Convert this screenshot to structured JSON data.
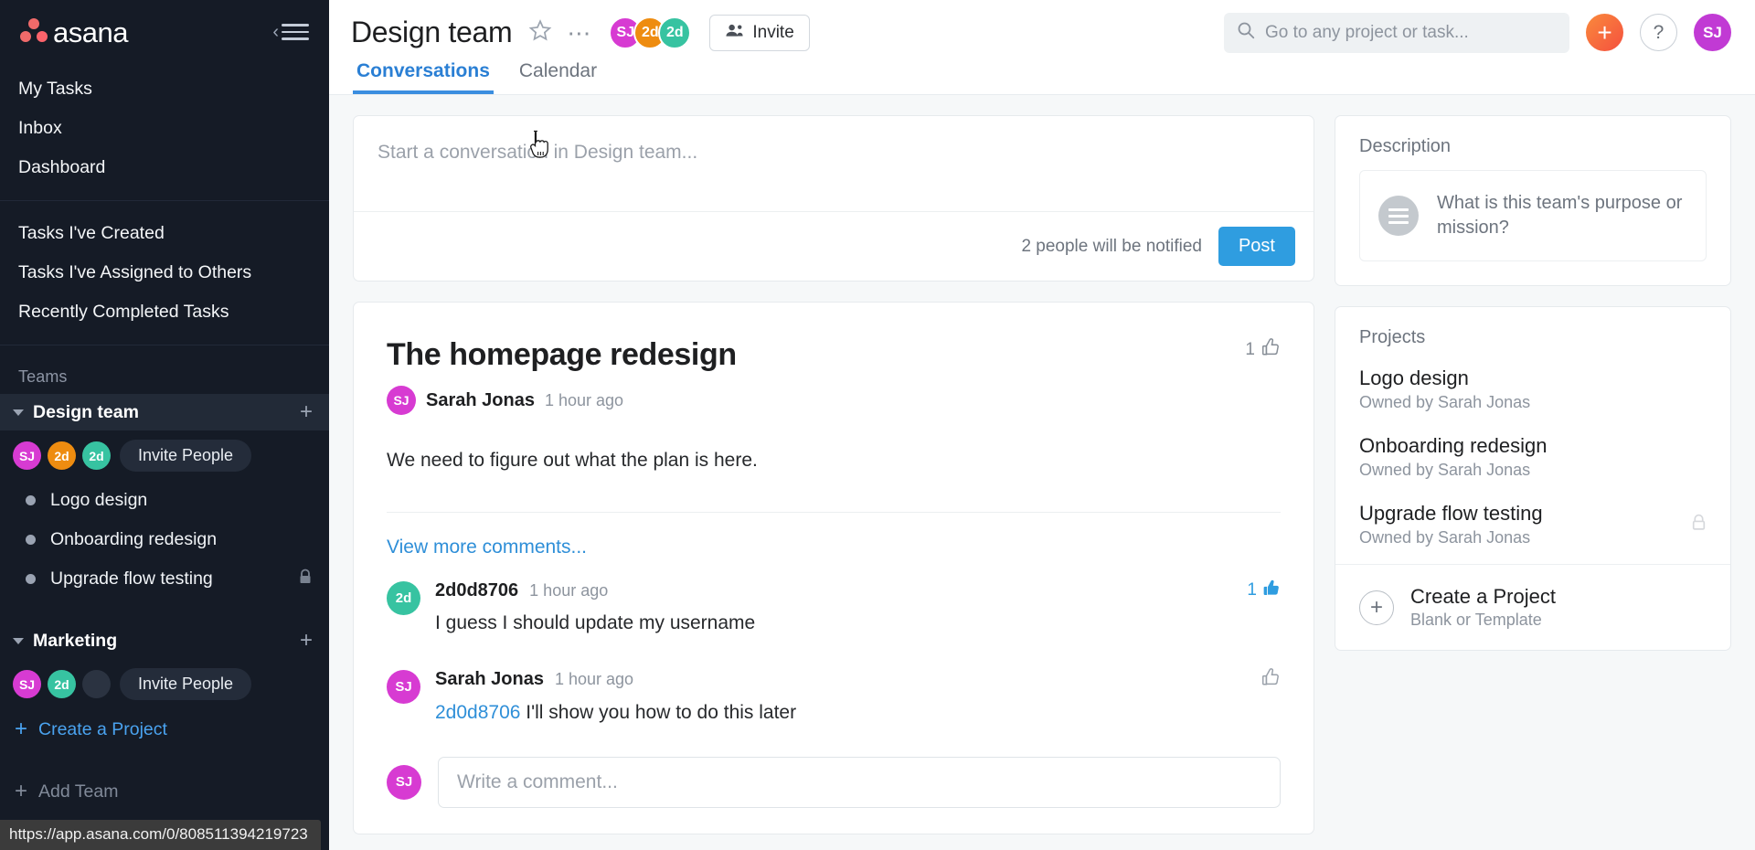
{
  "brand": {
    "name": "asana",
    "accent": "#2f9de0",
    "logo_color": "#f06a6a"
  },
  "sidebar": {
    "collapse_icon": "collapse-sidebar-icon",
    "nav": [
      {
        "label": "My Tasks"
      },
      {
        "label": "Inbox"
      },
      {
        "label": "Dashboard"
      }
    ],
    "nav2": [
      {
        "label": "Tasks I've Created"
      },
      {
        "label": "Tasks I've Assigned to Others"
      },
      {
        "label": "Recently Completed Tasks"
      }
    ],
    "teams_label": "Teams",
    "teams": [
      {
        "name": "Design team",
        "active": true,
        "members": [
          {
            "initials": "SJ",
            "color": "#d73bd2"
          },
          {
            "initials": "2d",
            "color": "#ee8c10"
          },
          {
            "initials": "2d",
            "color": "#37c3a1"
          }
        ],
        "invite_label": "Invite People",
        "projects": [
          {
            "label": "Logo design",
            "locked": false
          },
          {
            "label": "Onboarding redesign",
            "locked": false
          },
          {
            "label": "Upgrade flow testing",
            "locked": true
          }
        ]
      },
      {
        "name": "Marketing",
        "active": false,
        "members": [
          {
            "initials": "SJ",
            "color": "#d73bd2"
          },
          {
            "initials": "2d",
            "color": "#37c3a1"
          },
          {
            "initials": "",
            "color": "#2b3341"
          }
        ],
        "invite_label": "Invite People",
        "projects": []
      }
    ],
    "create_project_label": "Create a Project",
    "add_team_label": "Add Team"
  },
  "header": {
    "title": "Design team",
    "star_icon": "star-icon",
    "more_icon": "more-options-icon",
    "avatars": [
      {
        "initials": "SJ",
        "color": "#d73bd2"
      },
      {
        "initials": "2d",
        "color": "#ee8c10"
      },
      {
        "initials": "2d",
        "color": "#37c3a1"
      }
    ],
    "invite_label": "Invite",
    "search_placeholder": "Go to any project or task...",
    "add_label": "+",
    "help_label": "?",
    "me": {
      "initials": "SJ",
      "color": "#c13ad4"
    },
    "tabs": [
      {
        "label": "Conversations",
        "active": true
      },
      {
        "label": "Calendar",
        "active": false
      }
    ]
  },
  "composer": {
    "placeholder": "Start a conversation in Design team...",
    "notify_text": "2 people will be notified",
    "post_label": "Post"
  },
  "conversation": {
    "title": "The homepage redesign",
    "like_count": "1",
    "author": {
      "name": "Sarah Jonas",
      "initials": "SJ",
      "color": "#d73bd2"
    },
    "time": "1 hour ago",
    "body": "We need to figure out what the plan is here.",
    "view_more_label": "View more comments...",
    "comments": [
      {
        "author": "2d0d8706",
        "initials": "2d",
        "color": "#37c3a1",
        "time": "1 hour ago",
        "mention": "",
        "text": "I guess I should update my username",
        "like_count": "1",
        "liked": true
      },
      {
        "author": "Sarah Jonas",
        "initials": "SJ",
        "color": "#d73bd2",
        "time": "1 hour ago",
        "mention": "2d0d8706",
        "text": "I'll show you how to do this later",
        "like_count": "",
        "liked": false
      }
    ],
    "comment_placeholder": "Write a comment...",
    "comment_avatar": {
      "initials": "SJ",
      "color": "#d73bd2"
    }
  },
  "description_panel": {
    "title": "Description",
    "prompt": "What is this team's purpose or mission?"
  },
  "projects_panel": {
    "title": "Projects",
    "items": [
      {
        "name": "Logo design",
        "owner": "Owned by Sarah Jonas",
        "locked": false
      },
      {
        "name": "Onboarding redesign",
        "owner": "Owned by Sarah Jonas",
        "locked": false
      },
      {
        "name": "Upgrade flow testing",
        "owner": "Owned by Sarah Jonas",
        "locked": true
      }
    ],
    "create_title": "Create a Project",
    "create_subtitle": "Blank or Template"
  },
  "status_bar": {
    "url": "https://app.asana.com/0/808511394219723"
  }
}
